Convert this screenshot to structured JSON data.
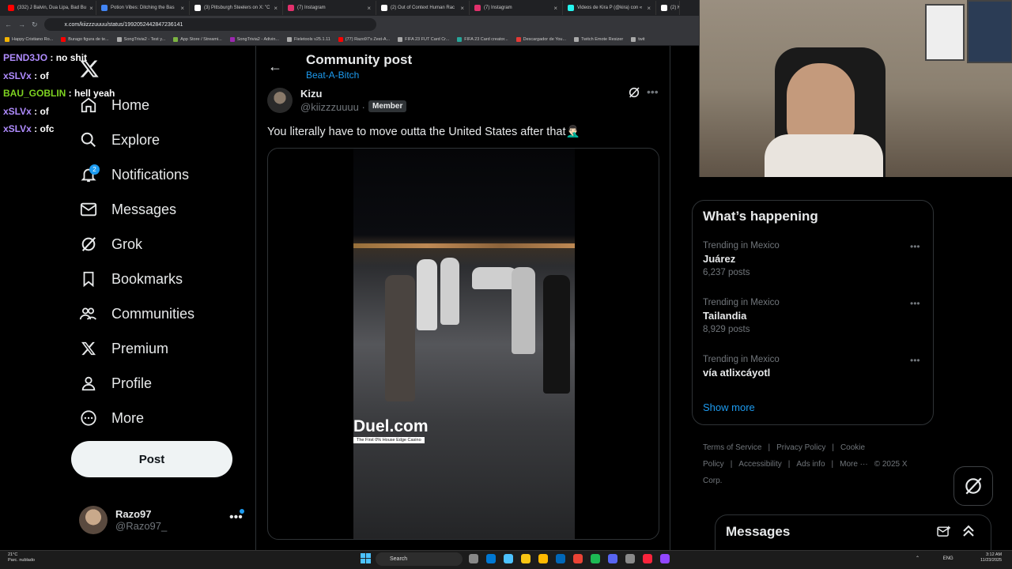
{
  "browser": {
    "tabs": [
      {
        "label": "(332) J Balvin, Dua Lipa, Bad Bu",
        "color": "#ff0000"
      },
      {
        "label": "Potion Vibes: Ditching the Bas",
        "color": "#4285f4"
      },
      {
        "label": "(3) Pittsburgh Steelers on X: \"C",
        "color": "#ffffff"
      },
      {
        "label": "(7) Instagram",
        "color": "#e1306c"
      },
      {
        "label": "(2) Out of Context Human Rac",
        "color": "#ffffff"
      },
      {
        "label": "(7) Instagram",
        "color": "#e1306c"
      },
      {
        "label": "Videos de Kira P (@kira) con «",
        "color": "#25f4ee"
      },
      {
        "label": "(2) Ki",
        "color": "#ffffff"
      }
    ],
    "url": "x.com/kiizzzuuuu/status/1992052442847236141",
    "bookmarks": [
      {
        "label": "Happy Cristiano Ro...",
        "color": "#f4b400"
      },
      {
        "label": "Burago figura de te...",
        "color": "#ff0000"
      },
      {
        "label": "SongTrivia2 - Test y...",
        "color": "#aaaaaa"
      },
      {
        "label": "App Store / Streami...",
        "color": "#7cb342"
      },
      {
        "label": "SongTrivia2 - Adivin...",
        "color": "#9c27b0"
      },
      {
        "label": "Fieletools v25.1.11",
        "color": "#aaaaaa"
      },
      {
        "label": "(77) Razo97's Zest-A...",
        "color": "#ff0000"
      },
      {
        "label": "FIFA 23 FUT Card Cr...",
        "color": "#aaaaaa"
      },
      {
        "label": "FIFA 23 Card creator...",
        "color": "#26a69a"
      },
      {
        "label": "Descargador de You...",
        "color": "#e53935"
      },
      {
        "label": "Twitch Emote Resizer",
        "color": "#aaaaaa"
      },
      {
        "label": "twit",
        "color": "#aaaaaa"
      }
    ]
  },
  "chat": [
    {
      "user": "PEND3JO",
      "color": "#b08cff",
      "message": "no shit"
    },
    {
      "user": "xSLVx",
      "color": "#b08cff",
      "message": "of"
    },
    {
      "user": "BAU_GOBLIN",
      "color": "#7ed321",
      "message": "hell yeah"
    },
    {
      "user": "xSLVx",
      "color": "#b08cff",
      "message": "of"
    },
    {
      "user": "xSLVx",
      "color": "#b08cff",
      "message": "ofc"
    }
  ],
  "nav": {
    "items": [
      {
        "label": "Home",
        "icon": "home-icon"
      },
      {
        "label": "Explore",
        "icon": "search-icon"
      },
      {
        "label": "Notifications",
        "icon": "bell-icon",
        "badge": "2"
      },
      {
        "label": "Messages",
        "icon": "envelope-icon"
      },
      {
        "label": "Grok",
        "icon": "grok-icon"
      },
      {
        "label": "Bookmarks",
        "icon": "bookmark-icon"
      },
      {
        "label": "Communities",
        "icon": "people-icon"
      },
      {
        "label": "Premium",
        "icon": "x-icon"
      },
      {
        "label": "Profile",
        "icon": "person-icon"
      },
      {
        "label": "More",
        "icon": "more-circle-icon"
      }
    ],
    "post_label": "Post",
    "account": {
      "name": "Razo97",
      "handle": "@Razo97_"
    }
  },
  "post": {
    "header_title": "Community post",
    "community": "Beat-A-Bitch",
    "author_name": "Kizu",
    "author_handle": "@kiizzzuuuu ·",
    "badge": "Member",
    "text": "You literally have to move outta the United States after that🤦🏻‍♂️",
    "video_brand": "Duel.com",
    "video_brand_sub": "The First 0% House Edge Casino"
  },
  "sidebar": {
    "happening_title": "What’s happening",
    "trends": [
      {
        "context": "Trending in Mexico",
        "name": "Juárez",
        "count": "6,237 posts"
      },
      {
        "context": "Trending in Mexico",
        "name": "Tailandia",
        "count": "8,929 posts"
      },
      {
        "context": "Trending in Mexico",
        "name": "vía atlixcáyotl",
        "count": ""
      }
    ],
    "show_more": "Show more",
    "footer": [
      "Terms of Service",
      "|",
      "Privacy Policy",
      "|",
      "Cookie Policy",
      "|",
      "Accessibility",
      "|",
      "Ads info",
      "|",
      "More ···",
      "© 2025 X Corp."
    ],
    "messages_title": "Messages"
  },
  "taskbar": {
    "weather_temp": "21°C",
    "weather_desc": "Parc. nublado",
    "search": "Search",
    "lang": "ENG",
    "time": "3:12 AM",
    "date": "11/23/2025"
  }
}
